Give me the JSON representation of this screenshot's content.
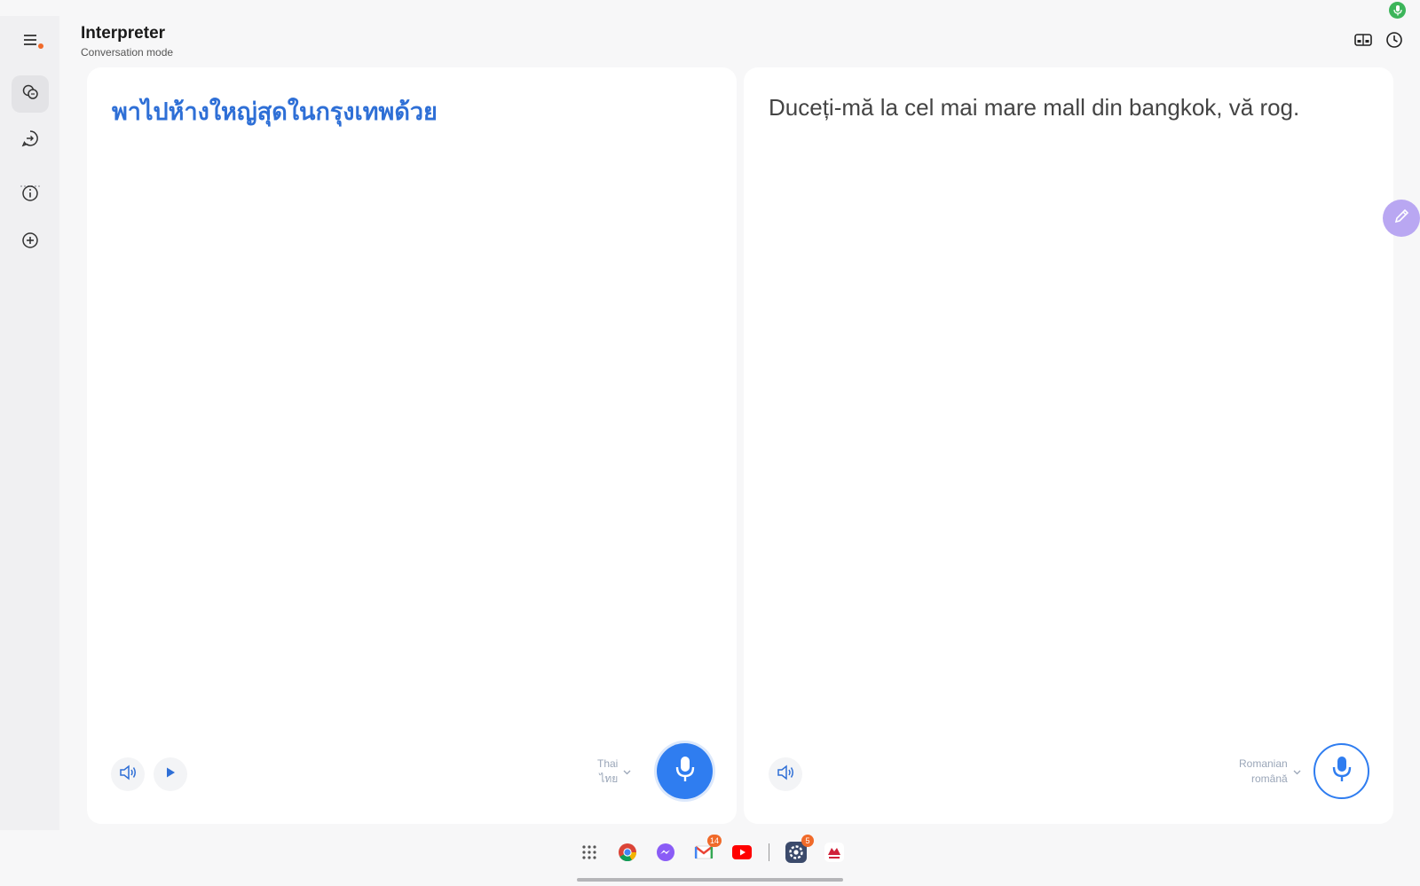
{
  "header": {
    "title": "Interpreter",
    "subtitle": "Conversation mode",
    "icons": [
      "split-screen-icon",
      "history-icon"
    ]
  },
  "status_bar": {
    "icon": "microphone-active-icon",
    "color": "#3cb55a"
  },
  "sidebar": {
    "items": [
      {
        "icon": "menu-icon",
        "has_notification_dot": true
      },
      {
        "icon": "conversation-icon",
        "active": true
      },
      {
        "icon": "chat-arrow-icon"
      },
      {
        "icon": "info-icon"
      },
      {
        "icon": "add-icon"
      }
    ]
  },
  "left_panel": {
    "text": "พาไปห้างใหญ่สุดในกรุงเทพด้วย",
    "language": {
      "name": "Thai",
      "native": "ไทย"
    },
    "controls": [
      "speaker-icon",
      "play-icon"
    ],
    "mic_style": "solid"
  },
  "right_panel": {
    "text": "Duceți-mă la cel mai mare mall din bangkok, vă rog.",
    "language": {
      "name": "Romanian",
      "native": "română"
    },
    "controls": [
      "speaker-icon"
    ],
    "mic_style": "outline"
  },
  "floating_button": {
    "icon": "edit-pen-icon"
  },
  "taskbar": {
    "apps": [
      {
        "name": "apps-grid-icon"
      },
      {
        "name": "chrome-icon"
      },
      {
        "name": "messenger-icon"
      },
      {
        "name": "gmail-icon",
        "badge": "14"
      },
      {
        "name": "youtube-icon"
      },
      {
        "name": "settings-icon",
        "badge": "5"
      },
      {
        "name": "app-shortcut-icon"
      }
    ]
  },
  "colors": {
    "accent": "#2f7df0",
    "source_text": "#2e6fd6",
    "badge": "#f06a2a"
  }
}
